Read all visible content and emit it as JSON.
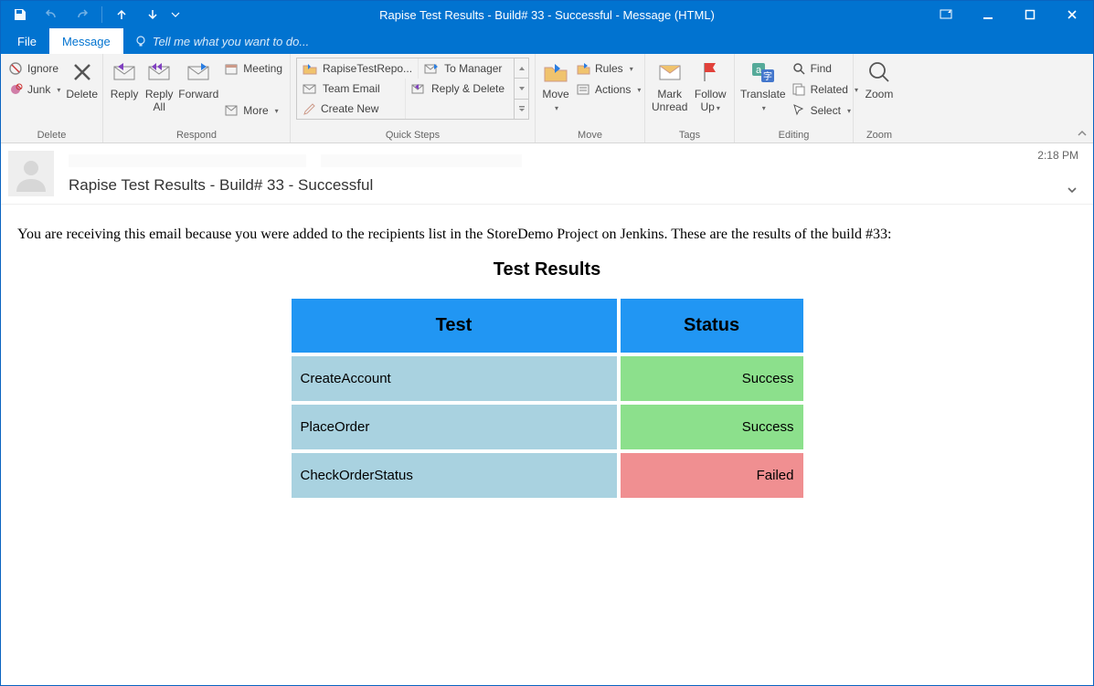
{
  "window_title": "Rapise Test Results - Build# 33 - Successful - Message (HTML)",
  "tabs": {
    "file": "File",
    "message": "Message"
  },
  "tellme_placeholder": "Tell me what you want to do...",
  "ribbon": {
    "delete": {
      "ignore": "Ignore",
      "junk": "Junk",
      "delete": "Delete",
      "group": "Delete"
    },
    "respond": {
      "reply": "Reply",
      "reply_all": "Reply\nAll",
      "forward": "Forward",
      "meeting": "Meeting",
      "more": "More",
      "group": "Respond"
    },
    "quicksteps": {
      "items": [
        "RapiseTestRepo...",
        "To Manager",
        "Team Email",
        "Reply & Delete",
        "Create New"
      ],
      "group": "Quick Steps"
    },
    "move": {
      "move": "Move",
      "rules": "Rules",
      "actions": "Actions",
      "group": "Move"
    },
    "tags": {
      "mark_unread": "Mark\nUnread",
      "follow_up": "Follow\nUp",
      "group": "Tags"
    },
    "editing": {
      "translate": "Translate",
      "find": "Find",
      "related": "Related",
      "select": "Select",
      "group": "Editing"
    },
    "zoom": {
      "zoom": "Zoom",
      "group": "Zoom"
    }
  },
  "message": {
    "timestamp": "2:18 PM",
    "subject": "Rapise Test Results - Build# 33 - Successful",
    "intro": "You are receiving this email because you were added to the recipients list in the StoreDemo Project on Jenkins. These are the results of the build #33:",
    "heading": "Test Results",
    "columns": {
      "test": "Test",
      "status": "Status"
    },
    "rows": [
      {
        "test": "CreateAccount",
        "status": "Success",
        "ok": true
      },
      {
        "test": "PlaceOrder",
        "status": "Success",
        "ok": true
      },
      {
        "test": "CheckOrderStatus",
        "status": "Failed",
        "ok": false
      }
    ]
  }
}
